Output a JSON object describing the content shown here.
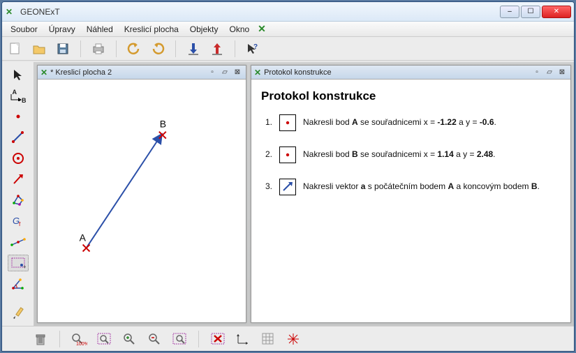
{
  "window": {
    "title": "GEONExT"
  },
  "menu": {
    "items": [
      "Soubor",
      "Úpravy",
      "Náhled",
      "Kreslicí plocha",
      "Objekty",
      "Okno"
    ]
  },
  "panels": {
    "drawing": {
      "title": "* Kreslicí plocha 2"
    },
    "protocol": {
      "title": "Protokol konstrukce",
      "heading": "Protokol konstrukce",
      "steps": [
        {
          "num": "1.",
          "icon": "point",
          "parts": [
            "Nakresli bod ",
            "A",
            " se souřadnicemi x = ",
            "-1.22",
            " a y = ",
            "-0.6",
            "."
          ]
        },
        {
          "num": "2.",
          "icon": "point",
          "parts": [
            "Nakresli bod ",
            "B",
            " se souřadnicemi x = ",
            "1.14",
            " a y = ",
            "2.48",
            "."
          ]
        },
        {
          "num": "3.",
          "icon": "vector",
          "parts": [
            "Nakresli vektor ",
            "a",
            " s počátečním bodem ",
            "A",
            " a koncovým bodem ",
            "B",
            "."
          ]
        }
      ]
    }
  },
  "canvas": {
    "points": {
      "A": {
        "label": "A",
        "x": -1.22,
        "y": -0.6
      },
      "B": {
        "label": "B",
        "x": 1.14,
        "y": 2.48
      }
    }
  }
}
